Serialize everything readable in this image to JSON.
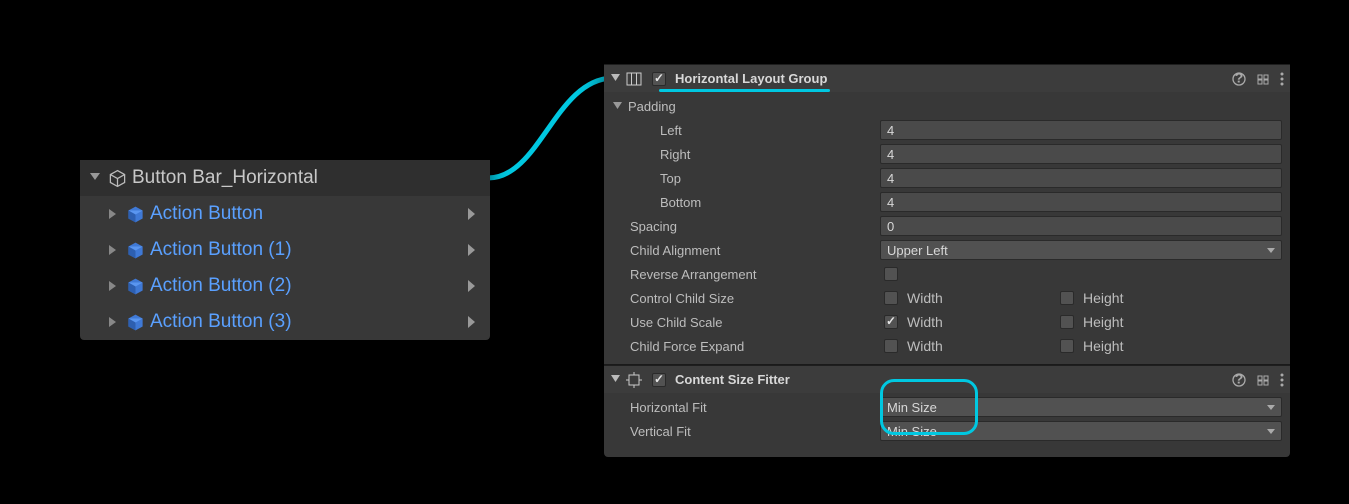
{
  "accent_color": "#00c8e1",
  "prefab_color": "#5aa0ff",
  "hierarchy": {
    "parent": {
      "label": "Button Bar_Horizontal",
      "expanded": true
    },
    "children": [
      {
        "label": "Action Button"
      },
      {
        "label": "Action Button (1)"
      },
      {
        "label": "Action Button (2)"
      },
      {
        "label": "Action Button (3)"
      }
    ]
  },
  "inspector": {
    "hlg": {
      "title": "Horizontal Layout Group",
      "enabled": true,
      "padding_label": "Padding",
      "padding": {
        "left_label": "Left",
        "left": "4",
        "right_label": "Right",
        "right": "4",
        "top_label": "Top",
        "top": "4",
        "bottom_label": "Bottom",
        "bottom": "4"
      },
      "spacing_label": "Spacing",
      "spacing": "0",
      "child_alignment_label": "Child Alignment",
      "child_alignment": "Upper Left",
      "reverse_label": "Reverse Arrangement",
      "reverse": false,
      "control_child_label": "Control Child Size",
      "use_child_scale_label": "Use Child Scale",
      "child_force_expand_label": "Child Force Expand",
      "width_label": "Width",
      "height_label": "Height",
      "control": {
        "width": false,
        "height": false
      },
      "scale": {
        "width": true,
        "height": false
      },
      "expand": {
        "width": false,
        "height": false
      }
    },
    "csf": {
      "title": "Content Size Fitter",
      "enabled": true,
      "h_label": "Horizontal Fit",
      "h_value": "Min Size",
      "v_label": "Vertical Fit",
      "v_value": "Min Size"
    }
  }
}
